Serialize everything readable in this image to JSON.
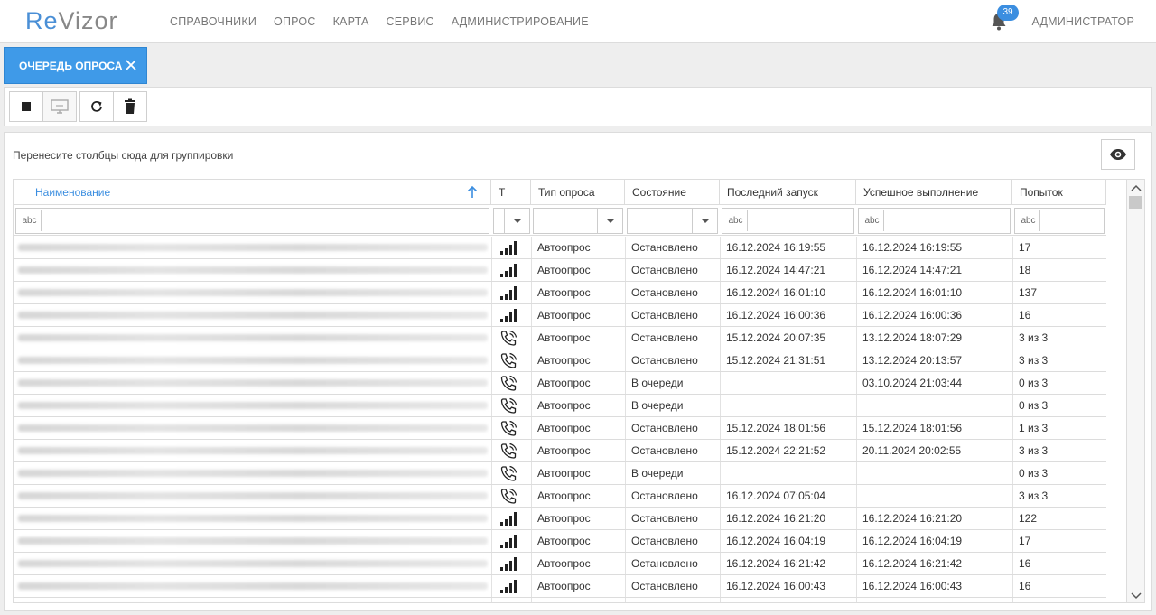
{
  "app": {
    "logo_re": "Re",
    "logo_vizor": "Vizor",
    "nav": [
      "СПРАВОЧНИКИ",
      "ОПРОС",
      "КАРТА",
      "СЕРВИС",
      "АДМИНИСТРИРОВАНИЕ"
    ],
    "notifications_count": "39",
    "user": "АДМИНИСТРАТОР"
  },
  "tab": {
    "label": "ОЧЕРЕДЬ ОПРОСА"
  },
  "toolbar": {
    "icons": [
      "stop-icon",
      "monitor-icon",
      "refresh-icon",
      "trash-icon"
    ]
  },
  "grid": {
    "group_hint": "Перенесите столбцы сюда для группировки",
    "columns": [
      "Наименование",
      "Т",
      "Тип опроса",
      "Состояние",
      "Последний запуск",
      "Успешное выполнение",
      "Попыток"
    ],
    "filter_abc": "abc",
    "rows": [
      {
        "icon": "signal",
        "type": "Автоопрос",
        "state": "Остановлено",
        "last": "16.12.2024 16:19:55",
        "success": "16.12.2024 16:19:55",
        "tries": "17"
      },
      {
        "icon": "signal",
        "type": "Автоопрос",
        "state": "Остановлено",
        "last": "16.12.2024 14:47:21",
        "success": "16.12.2024 14:47:21",
        "tries": "18"
      },
      {
        "icon": "signal",
        "type": "Автоопрос",
        "state": "Остановлено",
        "last": "16.12.2024 16:01:10",
        "success": "16.12.2024 16:01:10",
        "tries": "137"
      },
      {
        "icon": "signal",
        "type": "Автоопрос",
        "state": "Остановлено",
        "last": "16.12.2024 16:00:36",
        "success": "16.12.2024 16:00:36",
        "tries": "16"
      },
      {
        "icon": "phone",
        "type": "Автоопрос",
        "state": "Остановлено",
        "last": "15.12.2024 20:07:35",
        "success": "13.12.2024 18:07:29",
        "tries": "3 из 3"
      },
      {
        "icon": "phone",
        "type": "Автоопрос",
        "state": "Остановлено",
        "last": "15.12.2024 21:31:51",
        "success": "13.12.2024 20:13:57",
        "tries": "3 из 3"
      },
      {
        "icon": "phone",
        "type": "Автоопрос",
        "state": "В очереди",
        "last": "",
        "success": "03.10.2024 21:03:44",
        "tries": "0 из 3"
      },
      {
        "icon": "phone",
        "type": "Автоопрос",
        "state": "В очереди",
        "last": "",
        "success": "",
        "tries": "0 из 3"
      },
      {
        "icon": "phone",
        "type": "Автоопрос",
        "state": "Остановлено",
        "last": "15.12.2024 18:01:56",
        "success": "15.12.2024 18:01:56",
        "tries": "1 из 3"
      },
      {
        "icon": "phone",
        "type": "Автоопрос",
        "state": "Остановлено",
        "last": "15.12.2024 22:21:52",
        "success": "20.11.2024 20:02:55",
        "tries": "3 из 3"
      },
      {
        "icon": "phone",
        "type": "Автоопрос",
        "state": "В очереди",
        "last": "",
        "success": "",
        "tries": "0 из 3"
      },
      {
        "icon": "phone",
        "type": "Автоопрос",
        "state": "Остановлено",
        "last": "16.12.2024 07:05:04",
        "success": "",
        "tries": "3 из 3"
      },
      {
        "icon": "signal",
        "type": "Автоопрос",
        "state": "Остановлено",
        "last": "16.12.2024 16:21:20",
        "success": "16.12.2024 16:21:20",
        "tries": "122"
      },
      {
        "icon": "signal",
        "type": "Автоопрос",
        "state": "Остановлено",
        "last": "16.12.2024 16:04:19",
        "success": "16.12.2024 16:04:19",
        "tries": "17"
      },
      {
        "icon": "signal",
        "type": "Автоопрос",
        "state": "Остановлено",
        "last": "16.12.2024 16:21:42",
        "success": "16.12.2024 16:21:42",
        "tries": "16"
      },
      {
        "icon": "signal",
        "type": "Автоопрос",
        "state": "Остановлено",
        "last": "16.12.2024 16:00:43",
        "success": "16.12.2024 16:00:43",
        "tries": "16"
      },
      {
        "icon": "signal",
        "type": "",
        "state": "",
        "last": "",
        "success": "",
        "tries": ""
      }
    ]
  },
  "colors": {
    "accent": "#3f9ae8",
    "badge": "#3b8ee0"
  }
}
